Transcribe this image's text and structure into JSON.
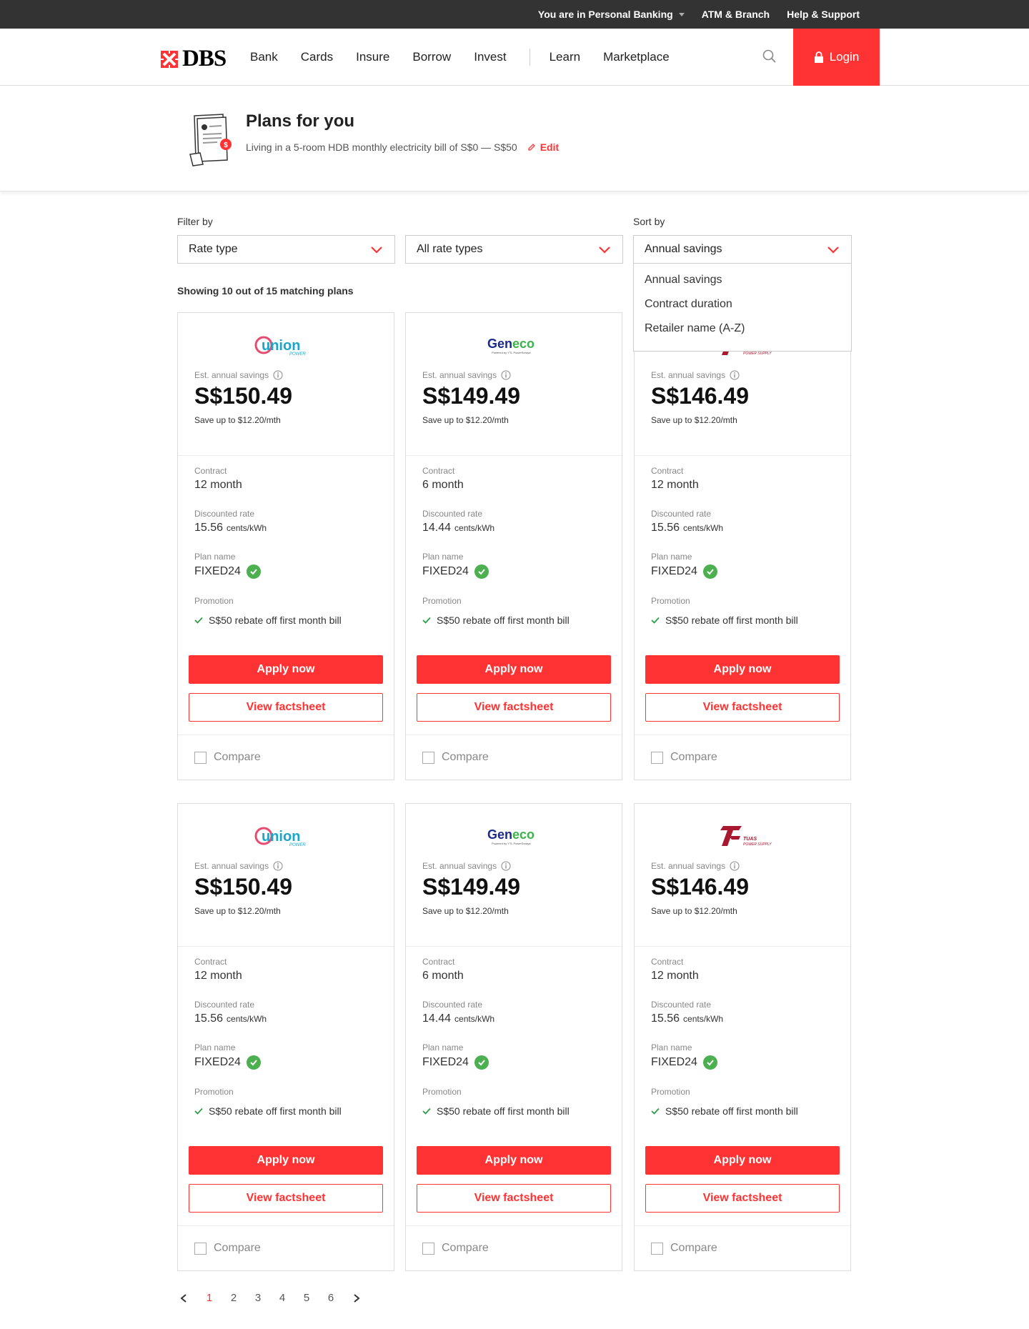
{
  "topbar": {
    "segment": "You are in Personal Banking",
    "atm": "ATM & Branch",
    "help": "Help & Support"
  },
  "nav": {
    "brand": "DBS",
    "items": [
      "Bank",
      "Cards",
      "Insure",
      "Borrow",
      "Invest",
      "Learn",
      "Marketplace"
    ],
    "login": "Login"
  },
  "hero": {
    "title": "Plans for you",
    "subtitle": "Living in a 5-room HDB monthly electricity bill of S$0 — S$50",
    "edit": "Edit"
  },
  "filters": {
    "filter_label": "Filter by",
    "sort_label": "Sort by",
    "rate_type": "Rate type",
    "rate_value": "All rate types",
    "sort_value": "Annual savings",
    "sort_options": [
      "Annual savings",
      "Contract duration",
      "Retailer name (A-Z)"
    ]
  },
  "showing": "Showing 10 out of 15 matching plans",
  "labels": {
    "savings": "Est. annual savings",
    "contract": "Contract",
    "rate": "Discounted rate",
    "rate_unit": "cents/kWh",
    "plan": "Plan name",
    "promotion": "Promotion",
    "apply": "Apply now",
    "factsheet": "View factsheet",
    "compare": "Compare"
  },
  "plans": [
    {
      "retailer": "Union",
      "retailer_sub": "POWER",
      "savings": "S$150.49",
      "save_note": "Save up to $12.20/mth",
      "contract": "12 month",
      "rate": "15.56",
      "plan": "FIXED24",
      "promo": "S$50 rebate off first month bill"
    },
    {
      "retailer": "Geneco",
      "retailer_sub": "Powered by YTL PowerSeraya",
      "savings": "S$149.49",
      "save_note": "Save up to $12.20/mth",
      "contract": "6 month",
      "rate": "14.44",
      "plan": "FIXED24",
      "promo": "S$50 rebate off first month bill"
    },
    {
      "retailer": "TUAS",
      "retailer_sub": "POWER SUPPLY",
      "savings": "S$146.49",
      "save_note": "Save up to $12.20/mth",
      "contract": "12 month",
      "rate": "15.56",
      "plan": "FIXED24",
      "promo": "S$50 rebate off first month bill"
    },
    {
      "retailer": "Union",
      "retailer_sub": "POWER",
      "savings": "S$150.49",
      "save_note": "Save up to $12.20/mth",
      "contract": "12 month",
      "rate": "15.56",
      "plan": "FIXED24",
      "promo": "S$50 rebate off first month bill"
    },
    {
      "retailer": "Geneco",
      "retailer_sub": "Powered by YTL PowerSeraya",
      "savings": "S$149.49",
      "save_note": "Save up to $12.20/mth",
      "contract": "6 month",
      "rate": "14.44",
      "plan": "FIXED24",
      "promo": "S$50 rebate off first month bill"
    },
    {
      "retailer": "TUAS",
      "retailer_sub": "POWER SUPPLY",
      "savings": "S$146.49",
      "save_note": "Save up to $12.20/mth",
      "contract": "12 month",
      "rate": "15.56",
      "plan": "FIXED24",
      "promo": "S$50 rebate off first month bill"
    }
  ],
  "pagination": {
    "pages": [
      "1",
      "2",
      "3",
      "4",
      "5",
      "6"
    ],
    "current": "1"
  },
  "colors": {
    "brand_red": "#ff3333",
    "topbar": "#333333",
    "badge_green": "#4caf50"
  }
}
